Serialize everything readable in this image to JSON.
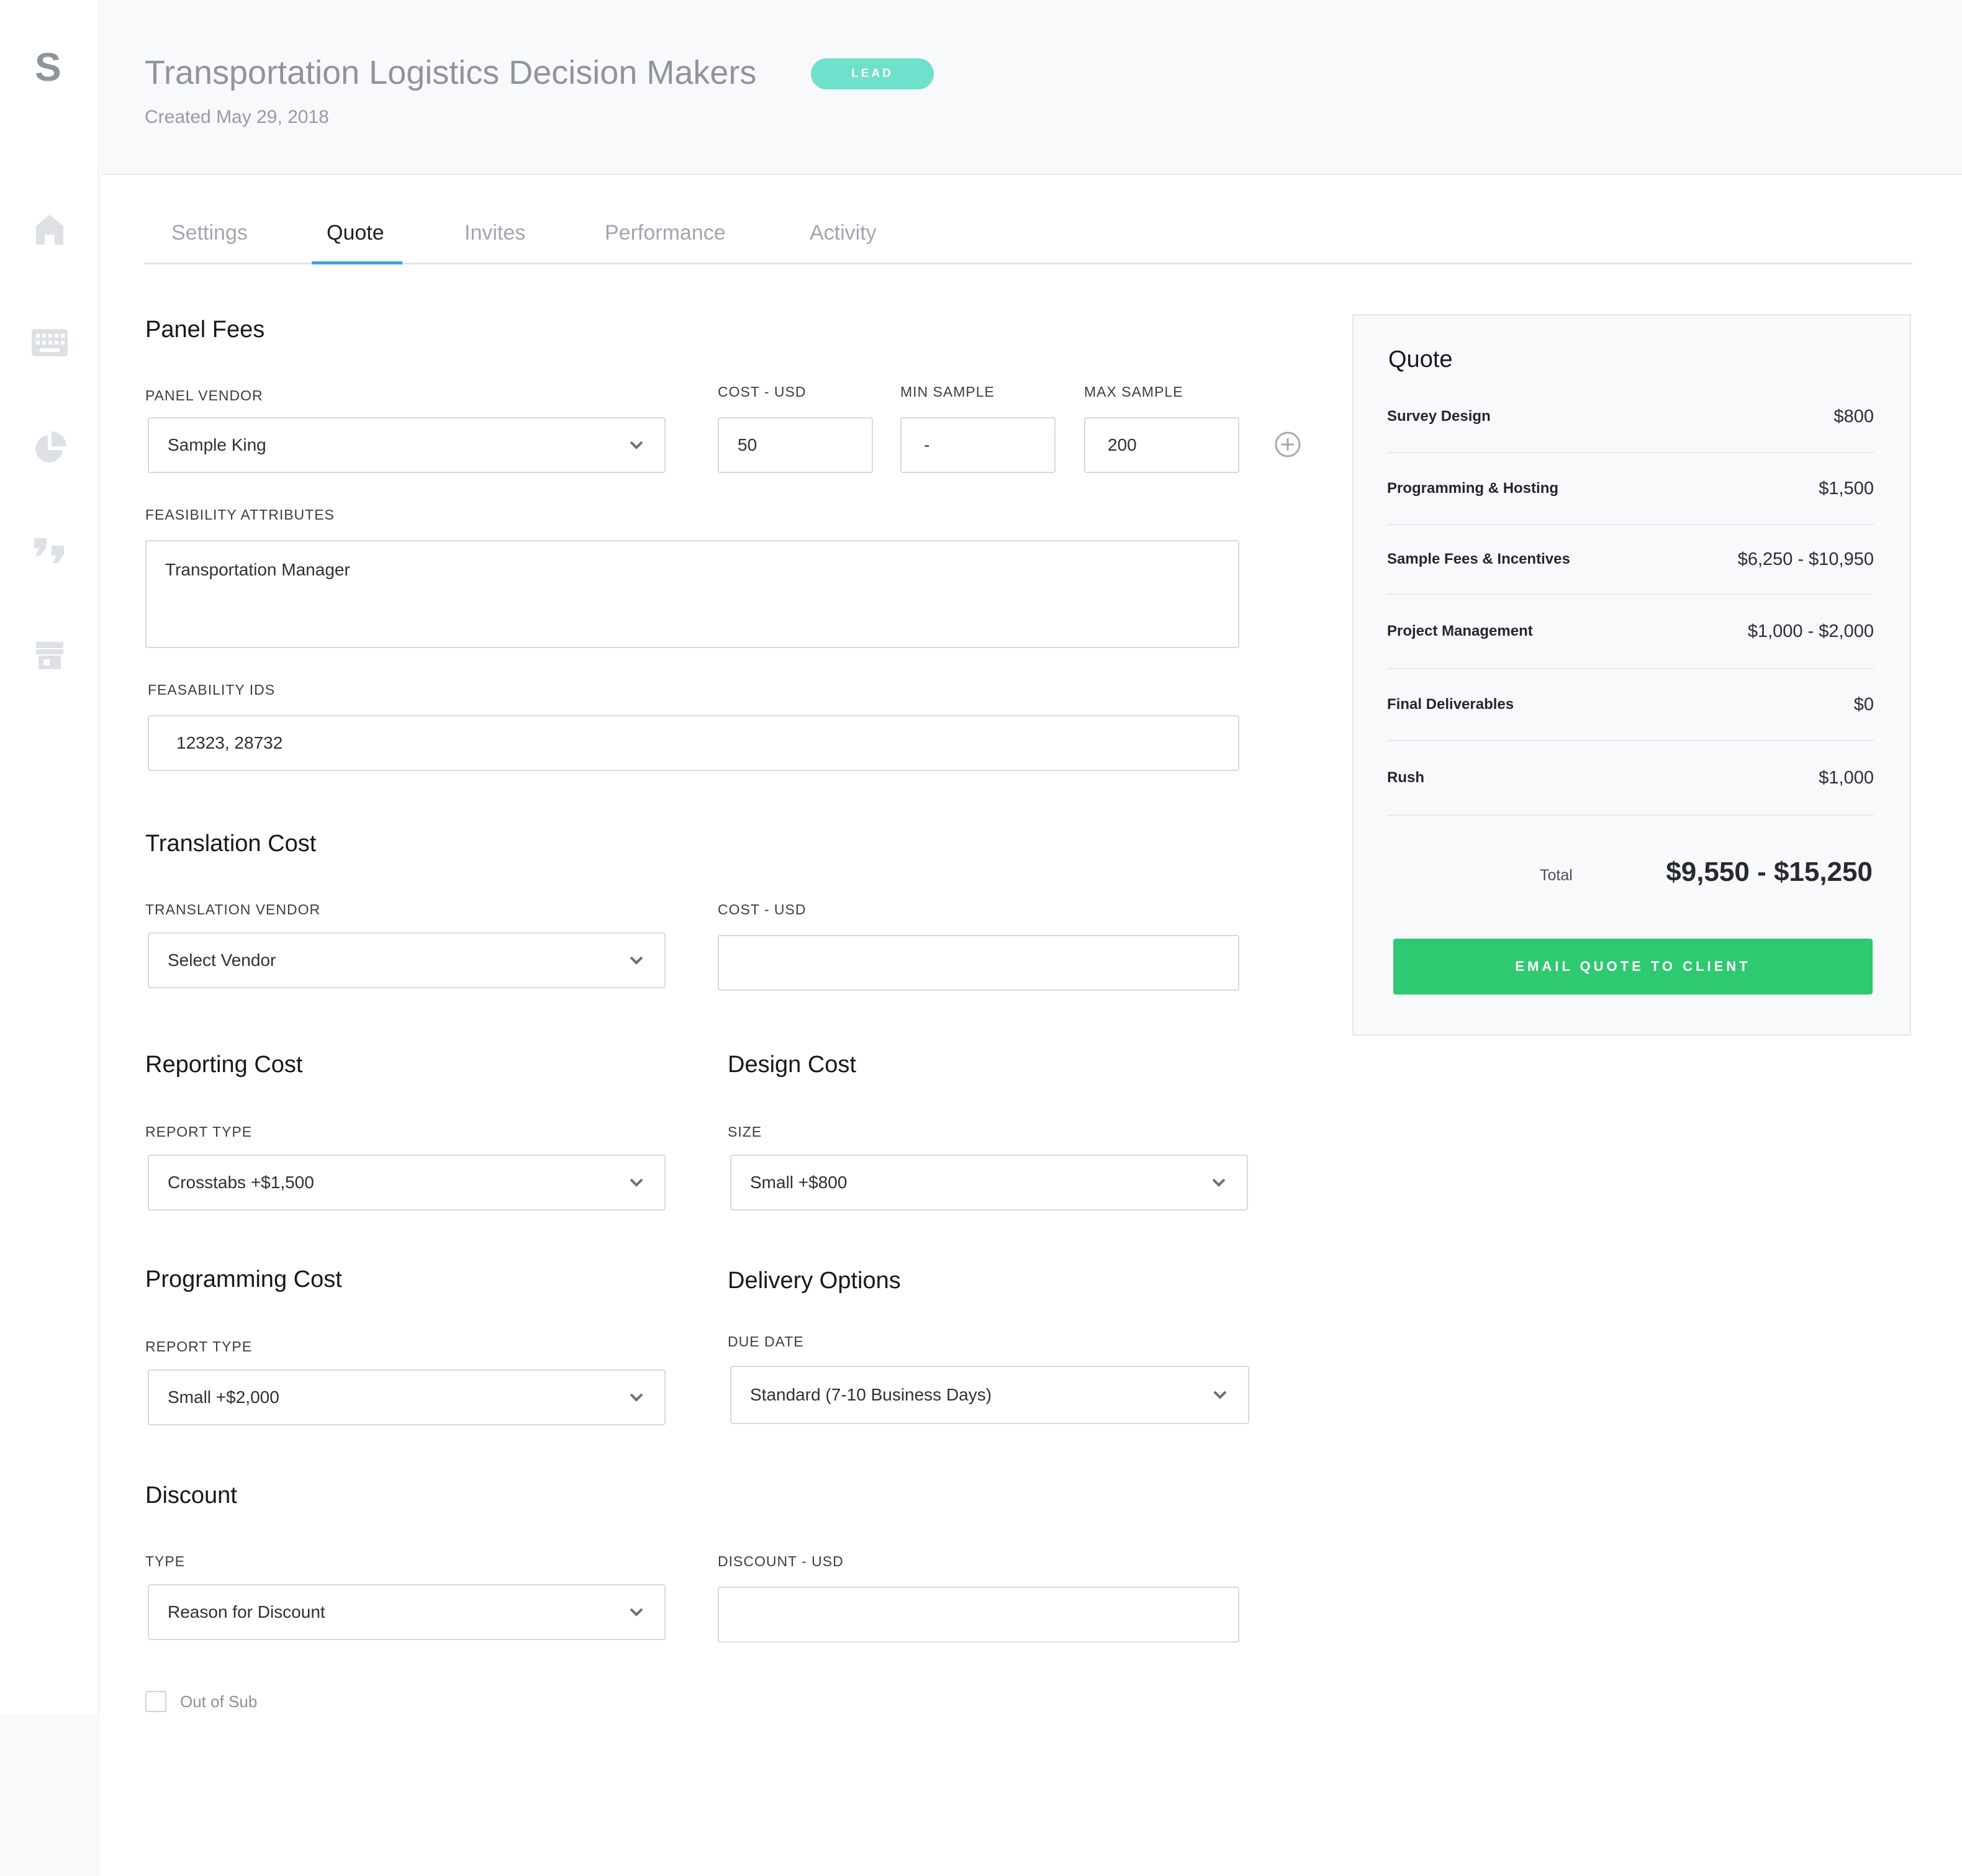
{
  "sidebar": {
    "logo": "S",
    "items": [
      {
        "icon": "home-icon"
      },
      {
        "icon": "keyboard-icon"
      },
      {
        "icon": "pie-chart-icon"
      },
      {
        "icon": "quotes-icon"
      },
      {
        "icon": "store-icon"
      }
    ]
  },
  "header": {
    "title": "Transportation Logistics Decision Makers",
    "badge": "LEAD",
    "created": "Created May 29, 2018"
  },
  "tabs": [
    {
      "label": "Settings",
      "active": false
    },
    {
      "label": "Quote",
      "active": true
    },
    {
      "label": "Invites",
      "active": false
    },
    {
      "label": "Performance",
      "active": false
    },
    {
      "label": "Activity",
      "active": false
    }
  ],
  "panel_fees": {
    "title": "Panel Fees",
    "vendor_label": "PANEL VENDOR",
    "vendor_value": "Sample King",
    "cost_label": "COST - USD",
    "cost_value": "50",
    "min_label": "MIN SAMPLE",
    "min_value": "-",
    "max_label": "MAX SAMPLE",
    "max_value": "200",
    "attributes_label": "FEASIBILITY ATTRIBUTES",
    "attributes_value": "Transportation Manager",
    "ids_label": "FEASABILITY IDS",
    "ids_value": "12323, 28732"
  },
  "translation": {
    "title": "Translation Cost",
    "vendor_label": "TRANSLATION VENDOR",
    "vendor_value": "Select Vendor",
    "cost_label": "COST - USD",
    "cost_value": ""
  },
  "reporting": {
    "title": "Reporting Cost",
    "type_label": "REPORT TYPE",
    "type_value": "Crosstabs +$1,500"
  },
  "design": {
    "title": "Design Cost",
    "size_label": "SIZE",
    "size_value": "Small +$800"
  },
  "programming": {
    "title": "Programming Cost",
    "type_label": "REPORT TYPE",
    "type_value": "Small +$2,000"
  },
  "delivery": {
    "title": "Delivery Options",
    "due_label": "DUE DATE",
    "due_value": "Standard (7-10 Business Days)"
  },
  "discount": {
    "title": "Discount",
    "type_label": "TYPE",
    "type_value": "Reason for Discount",
    "amount_label": "DISCOUNT - USD",
    "amount_value": ""
  },
  "out_of_sub": {
    "label": "Out of Sub",
    "checked": false
  },
  "quote": {
    "title": "Quote",
    "rows": [
      {
        "label": "Survey Design",
        "amount": "$800"
      },
      {
        "label": "Programming & Hosting",
        "amount": "$1,500"
      },
      {
        "label": "Sample Fees & Incentives",
        "amount": "$6,250 - $10,950"
      },
      {
        "label": "Project Management",
        "amount": "$1,000 - $2,000"
      },
      {
        "label": "Final Deliverables",
        "amount": "$0"
      },
      {
        "label": "Rush",
        "amount": "$1,000"
      }
    ],
    "total_label": "Total",
    "total_value": "$9,550 - $15,250",
    "button_label": "EMAIL QUOTE TO CLIENT"
  },
  "colors": {
    "accent": "#3fa4e3",
    "badge": "#6ee0cc",
    "primary_button": "#2ec971"
  }
}
